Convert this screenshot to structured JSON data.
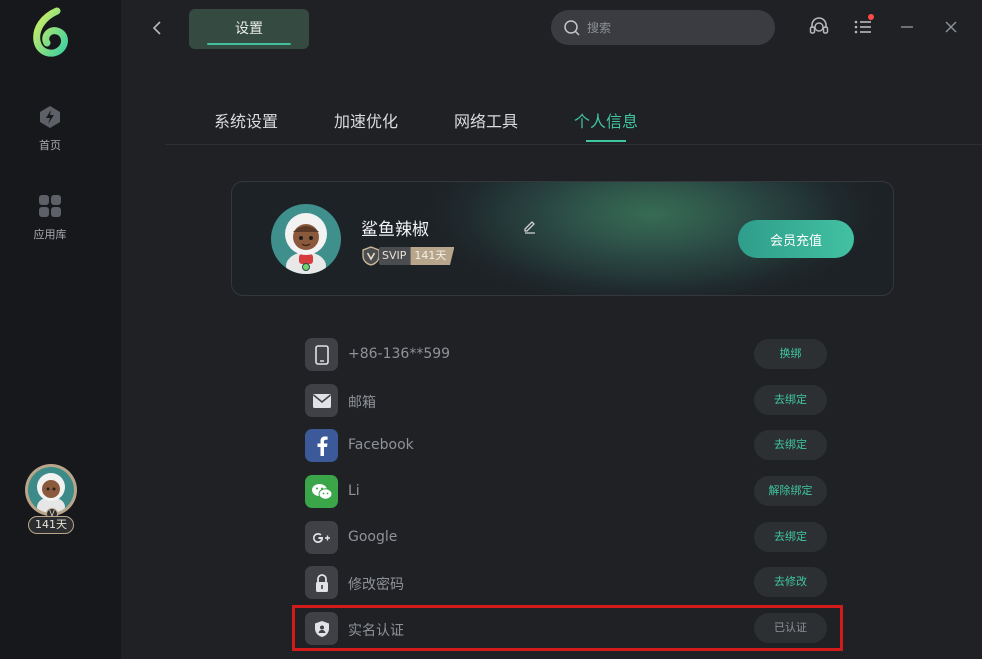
{
  "rail": {
    "home_label": "首页",
    "apps_label": "应用库",
    "avatar_days": "141天"
  },
  "header": {
    "title": "设置",
    "search_placeholder": "搜索"
  },
  "tabs": [
    {
      "label": "系统设置",
      "active": false
    },
    {
      "label": "加速优化",
      "active": false
    },
    {
      "label": "网络工具",
      "active": false
    },
    {
      "label": "个人信息",
      "active": true
    }
  ],
  "profile": {
    "username": "鲨鱼辣椒",
    "vip_level": "SVIP",
    "vip_days": "141天",
    "recharge_label": "会员充值"
  },
  "accounts": [
    {
      "icon": "phone-icon",
      "label": "+86-136**599",
      "action": "换绑"
    },
    {
      "icon": "mail-icon",
      "label": "邮箱",
      "action": "去绑定"
    },
    {
      "icon": "facebook-icon",
      "label": "Facebook",
      "action": "去绑定"
    },
    {
      "icon": "wechat-icon",
      "label": "Li",
      "action": "解除绑定"
    },
    {
      "icon": "google-icon",
      "label": "Google",
      "action": "去绑定"
    },
    {
      "icon": "lock-icon",
      "label": "修改密码",
      "action": "去修改"
    },
    {
      "icon": "id-shield-icon",
      "label": "实名认证",
      "action": "已认证"
    }
  ],
  "colors": {
    "accent": "#3fc6a0",
    "highlight_border": "#d21b1b",
    "background": "#1f2125",
    "rail": "#17181b"
  }
}
